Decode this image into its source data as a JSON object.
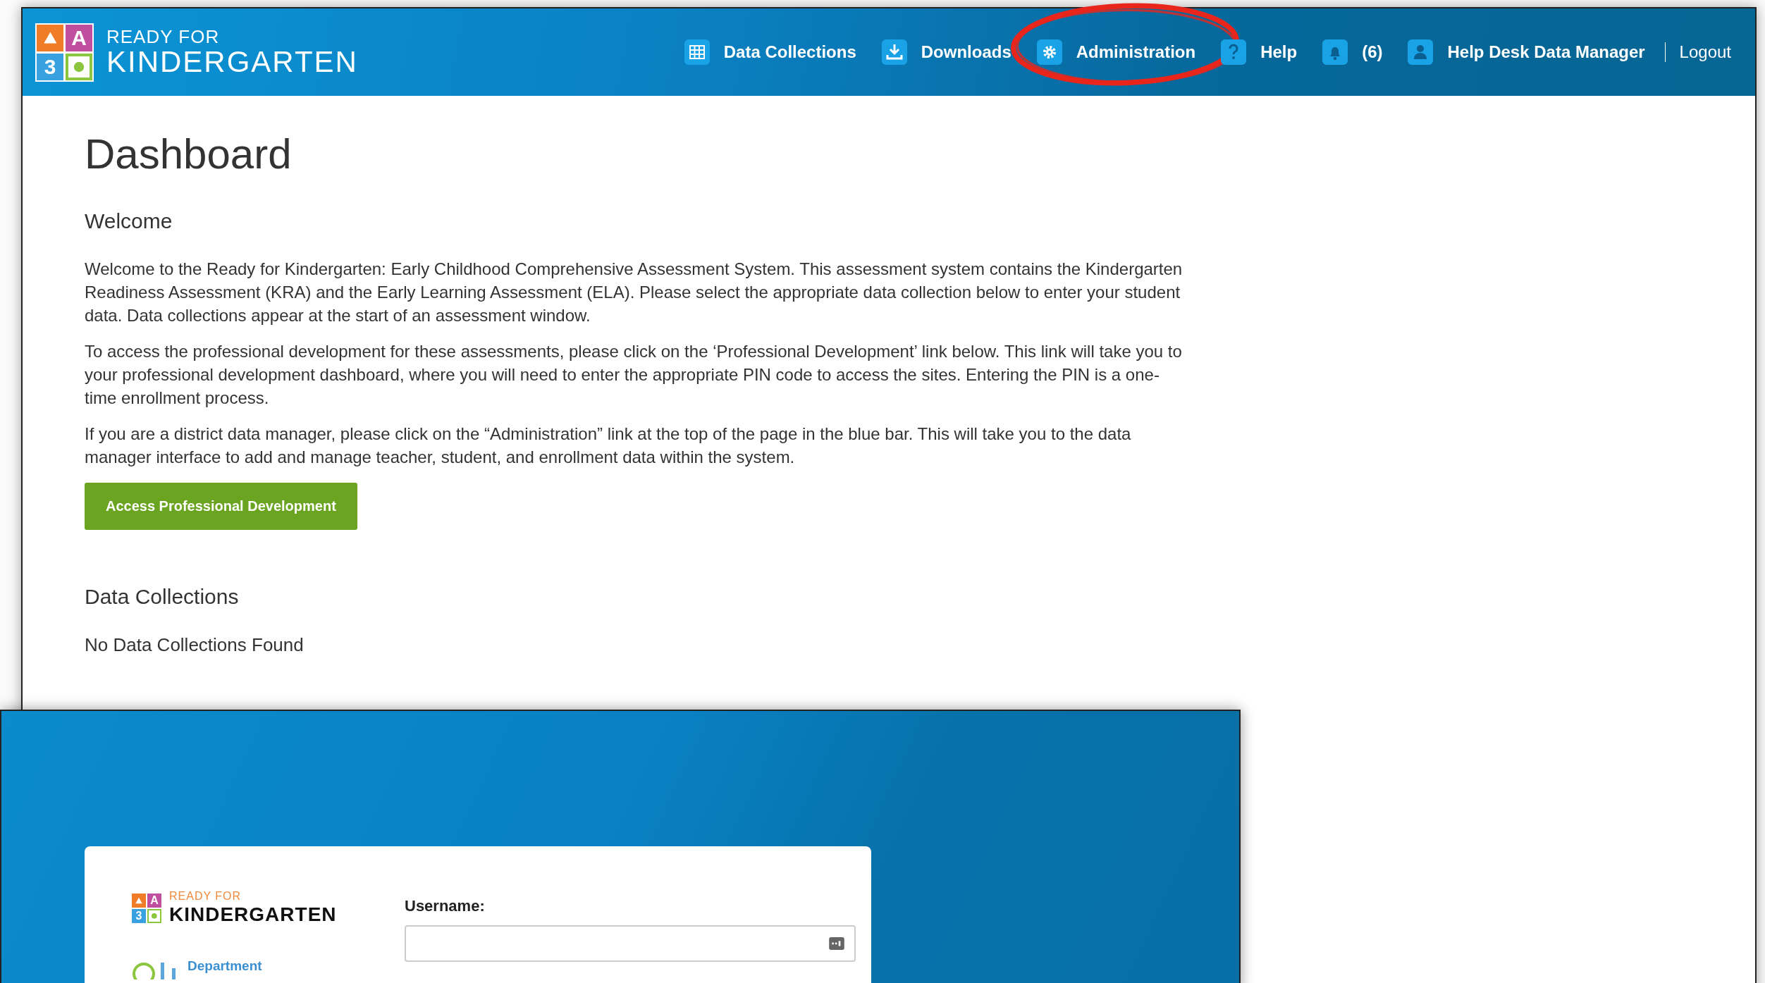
{
  "dashboard": {
    "header": {
      "logo": {
        "block_letter": "A",
        "block_digit": "3",
        "line_1": "READY FOR",
        "line_2": "KINDERGARTEN"
      },
      "nav": [
        {
          "kind": "grid",
          "label": "Data Collections",
          "highlighted": false
        },
        {
          "kind": "download",
          "label": "Downloads",
          "highlighted": false
        },
        {
          "kind": "gear",
          "label": "Administration",
          "highlighted": true
        },
        {
          "kind": "question",
          "label": "Help",
          "highlighted": false
        },
        {
          "kind": "bell",
          "label": "(6)",
          "highlighted": false
        },
        {
          "kind": "user",
          "label": "Help Desk Data Manager",
          "highlighted": false
        }
      ],
      "logout": "Logout"
    },
    "title": "Dashboard",
    "welcome_heading": "Welcome",
    "paragraphs": [
      "Welcome to the Ready for Kindergarten: Early Childhood Comprehensive Assessment System. This assessment system contains the Kindergarten Readiness Assessment (KRA) and the Early Learning Assessment (ELA). Please select the appropriate data collection below to enter your student data. Data collections appear at the start of an assessment window.",
      "To access the professional development for these assessments, please click on the ‘Professional Development’ link below. This link will take you to your professional development dashboard, where you will need to enter the appropriate PIN code to access the sites. Entering the PIN is a one-time enrollment process.",
      "If you are a district data manager, please click on the “Administration” link at the top of the page in the blue bar. This will take you to the data manager interface to add and manage teacher, student, and enrollment data within the system."
    ],
    "button": "Access Professional Development",
    "collections_heading": "Data Collections",
    "collections_empty": "No Data Collections Found"
  },
  "login": {
    "logo": {
      "block_letter": "A",
      "block_digit": "3",
      "line_1": "READY FOR",
      "line_2": "KINDERGARTEN"
    },
    "department_label": "Department",
    "username_label": "Username:"
  }
}
